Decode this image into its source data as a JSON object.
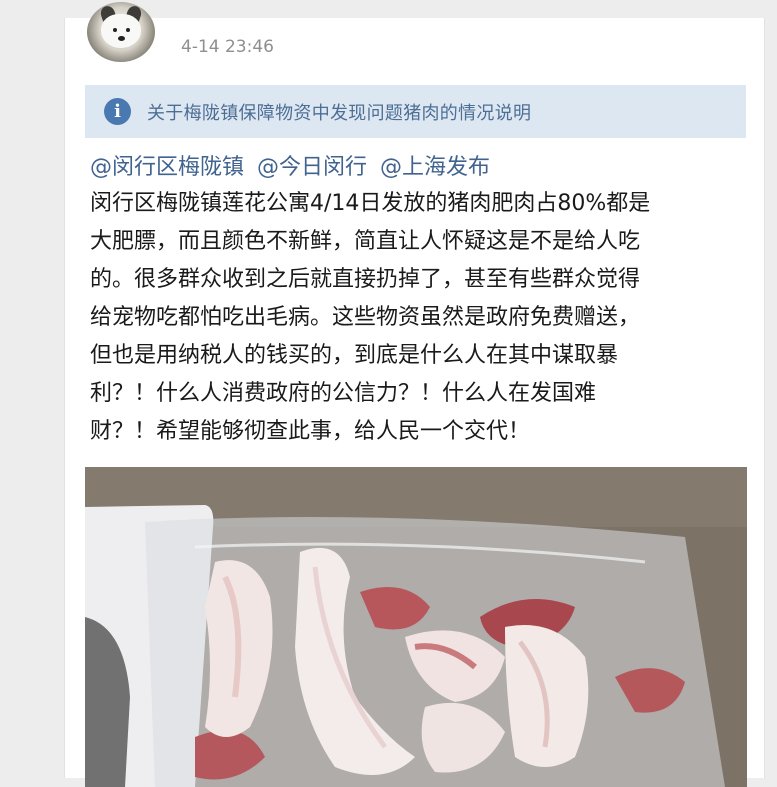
{
  "post": {
    "timestamp": "4-14 23:46",
    "notice": {
      "icon": "info-icon",
      "text": "关于梅陇镇保障物资中发现问题猪肉的情况说明"
    },
    "mentions": [
      "@闵行区梅陇镇",
      "@今日闵行",
      "@上海发布"
    ],
    "body_lines": [
      "闵行区梅陇镇莲花公寓4/14日发放的猪肉肥肉占80%都是",
      "大肥膘，而且颜色不新鲜，简直让人怀疑这是不是给人吃",
      "的。很多群众收到之后就直接扔掉了，甚至有些群众觉得",
      "给宠物吃都怕吃出毛病。这些物资虽然是政府免费赠送，",
      "但也是用纳税人的钱买的，到底是什么人在其中谋取暴",
      "利？！什么人消费政府的公信力？！什么人在发国难",
      "财？！希望能够彻查此事，给人民一个交代！"
    ]
  },
  "colors": {
    "link": "#41638f",
    "notice_bg": "#dde7f1",
    "notice_text": "#4d6f96",
    "info_icon": "#4a78b0",
    "timestamp": "#8f8f8f"
  }
}
